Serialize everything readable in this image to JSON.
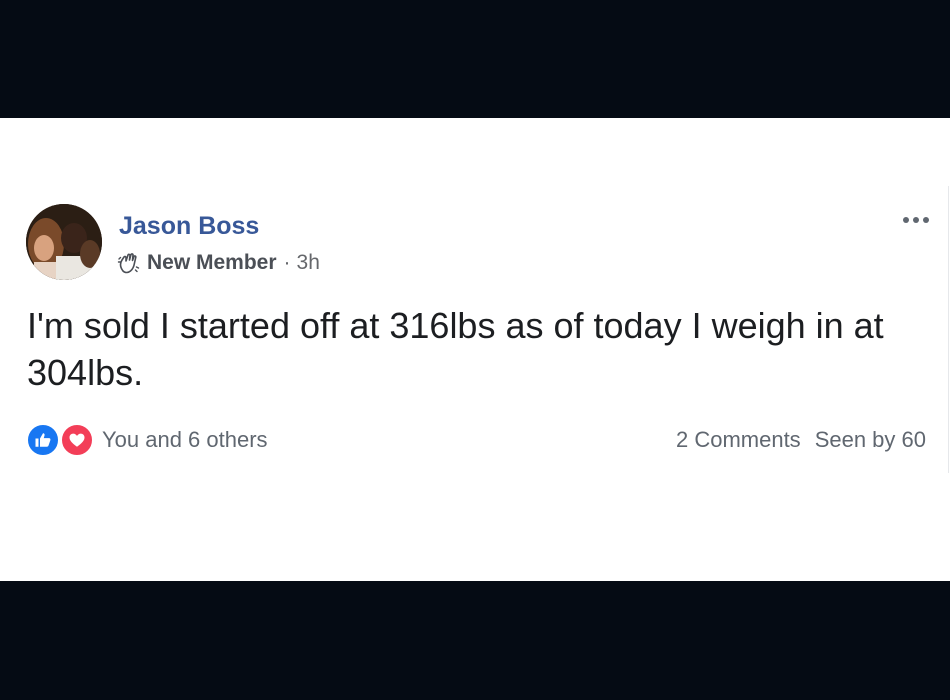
{
  "post": {
    "author": "Jason Boss",
    "badge": "New Member",
    "separator": "·",
    "time": "3h",
    "text": "I'm sold I started off at 316lbs as of today I weigh in at 304lbs.",
    "reactions_text": "You and 6 others",
    "comments_text": "2 Comments",
    "seen_text": "Seen by 60"
  },
  "icons": {
    "badge": "waving-hand-icon",
    "more": "more-options-icon",
    "like": "like-reaction-icon",
    "love": "love-reaction-icon"
  },
  "colors": {
    "author": "#385898",
    "like": "#1877f2",
    "love": "#f33e58",
    "background_bars": "#050b14"
  }
}
